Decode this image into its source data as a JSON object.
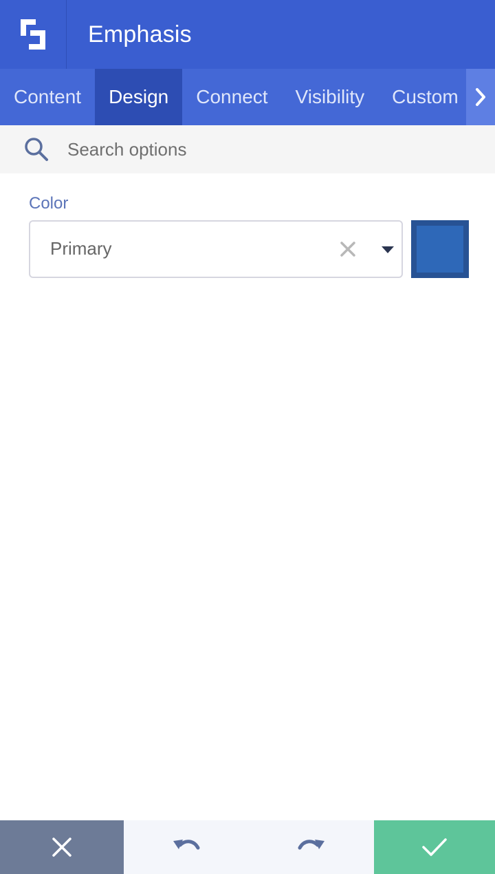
{
  "header": {
    "title": "Emphasis",
    "logo_icon": "builder-logo-icon"
  },
  "tabs": [
    {
      "label": "Content",
      "active": false
    },
    {
      "label": "Design",
      "active": true
    },
    {
      "label": "Connect",
      "active": false
    },
    {
      "label": "Visibility",
      "active": false
    },
    {
      "label": "Custom",
      "active": false
    }
  ],
  "tab_scroll_icon": "chevron-right-icon",
  "search": {
    "placeholder": "Search options",
    "icon": "search-icon"
  },
  "color_field": {
    "label": "Color",
    "value": "Primary",
    "clear_icon": "close-icon",
    "dropdown_icon": "caret-down-icon",
    "swatch_color": "#2e68b8",
    "swatch_border_color": "#275294"
  },
  "footer": {
    "cancel_icon": "close-icon",
    "undo_icon": "undo-icon",
    "redo_icon": "redo-icon",
    "save_icon": "checkmark-icon"
  },
  "colors": {
    "header_bg": "#3a5ed0",
    "tabs_bg": "#4468d6",
    "active_tab_bg": "#2d4db3",
    "cancel_bg": "#6d7b97",
    "save_bg": "#5ec59a"
  }
}
